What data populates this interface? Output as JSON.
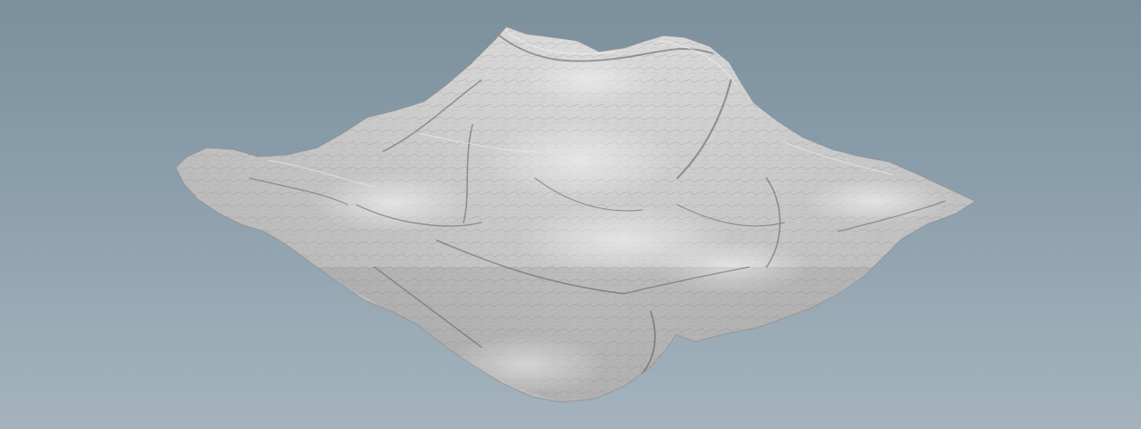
{
  "viewport": {
    "background_top": "#7b8f9d",
    "background_bottom": "#a4b3bd",
    "object": "terrain-heightfield-mesh",
    "shading": "grey-clay"
  },
  "colors": {
    "terrain_light": "#d4d4d4",
    "terrain_mid": "#b5b5b5",
    "terrain_dark": "#5f5f5f",
    "ridge_line": "#6e6e6e"
  }
}
